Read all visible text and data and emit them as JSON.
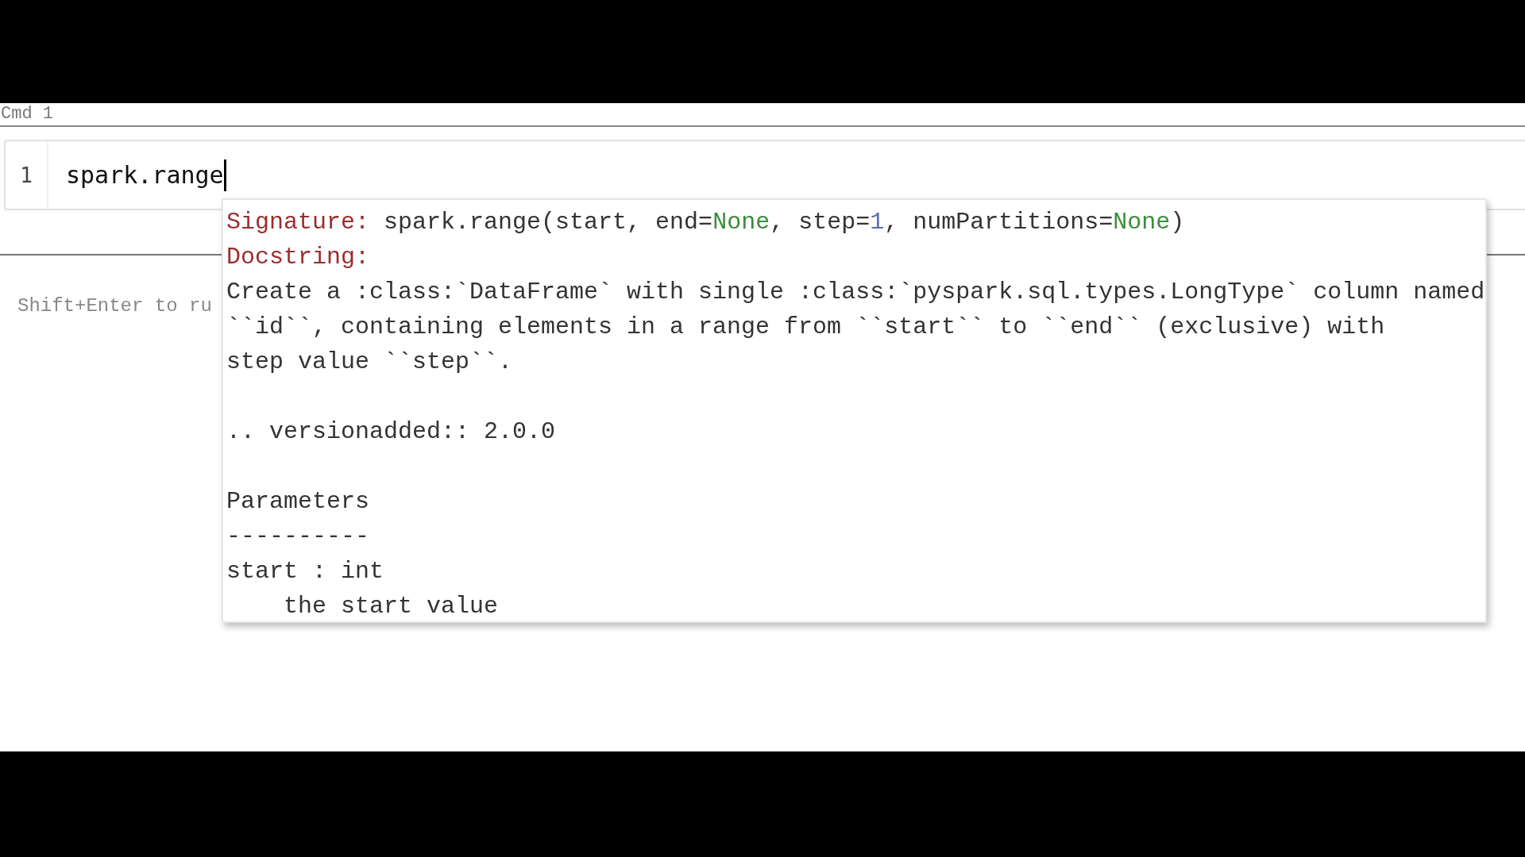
{
  "cell": {
    "label": "Cmd 1",
    "line_number": "1",
    "code": "spark.range",
    "hint": "Shift+Enter to ru"
  },
  "tooltip": {
    "signature_label": "Signature:",
    "signature": [
      {
        "kind": "plain",
        "text": "spark.range(start, end="
      },
      {
        "kind": "keyword",
        "text": "None"
      },
      {
        "kind": "plain",
        "text": ", step="
      },
      {
        "kind": "number",
        "text": "1"
      },
      {
        "kind": "plain",
        "text": ", numPartitions="
      },
      {
        "kind": "keyword",
        "text": "None"
      },
      {
        "kind": "plain",
        "text": ")"
      }
    ],
    "docstring_label": "Docstring:",
    "docstring": [
      [
        "Create a :class:`DataFrame` with single :class:`pyspark.sql.types.LongType` column named",
        "``id``, containing elements in a range from ``start`` to ``end`` (exclusive) with",
        "step value ``step``."
      ],
      [
        ".. versionadded:: 2.0.0"
      ],
      [
        "Parameters",
        "----------",
        "start : int",
        "    the start value"
      ]
    ]
  }
}
